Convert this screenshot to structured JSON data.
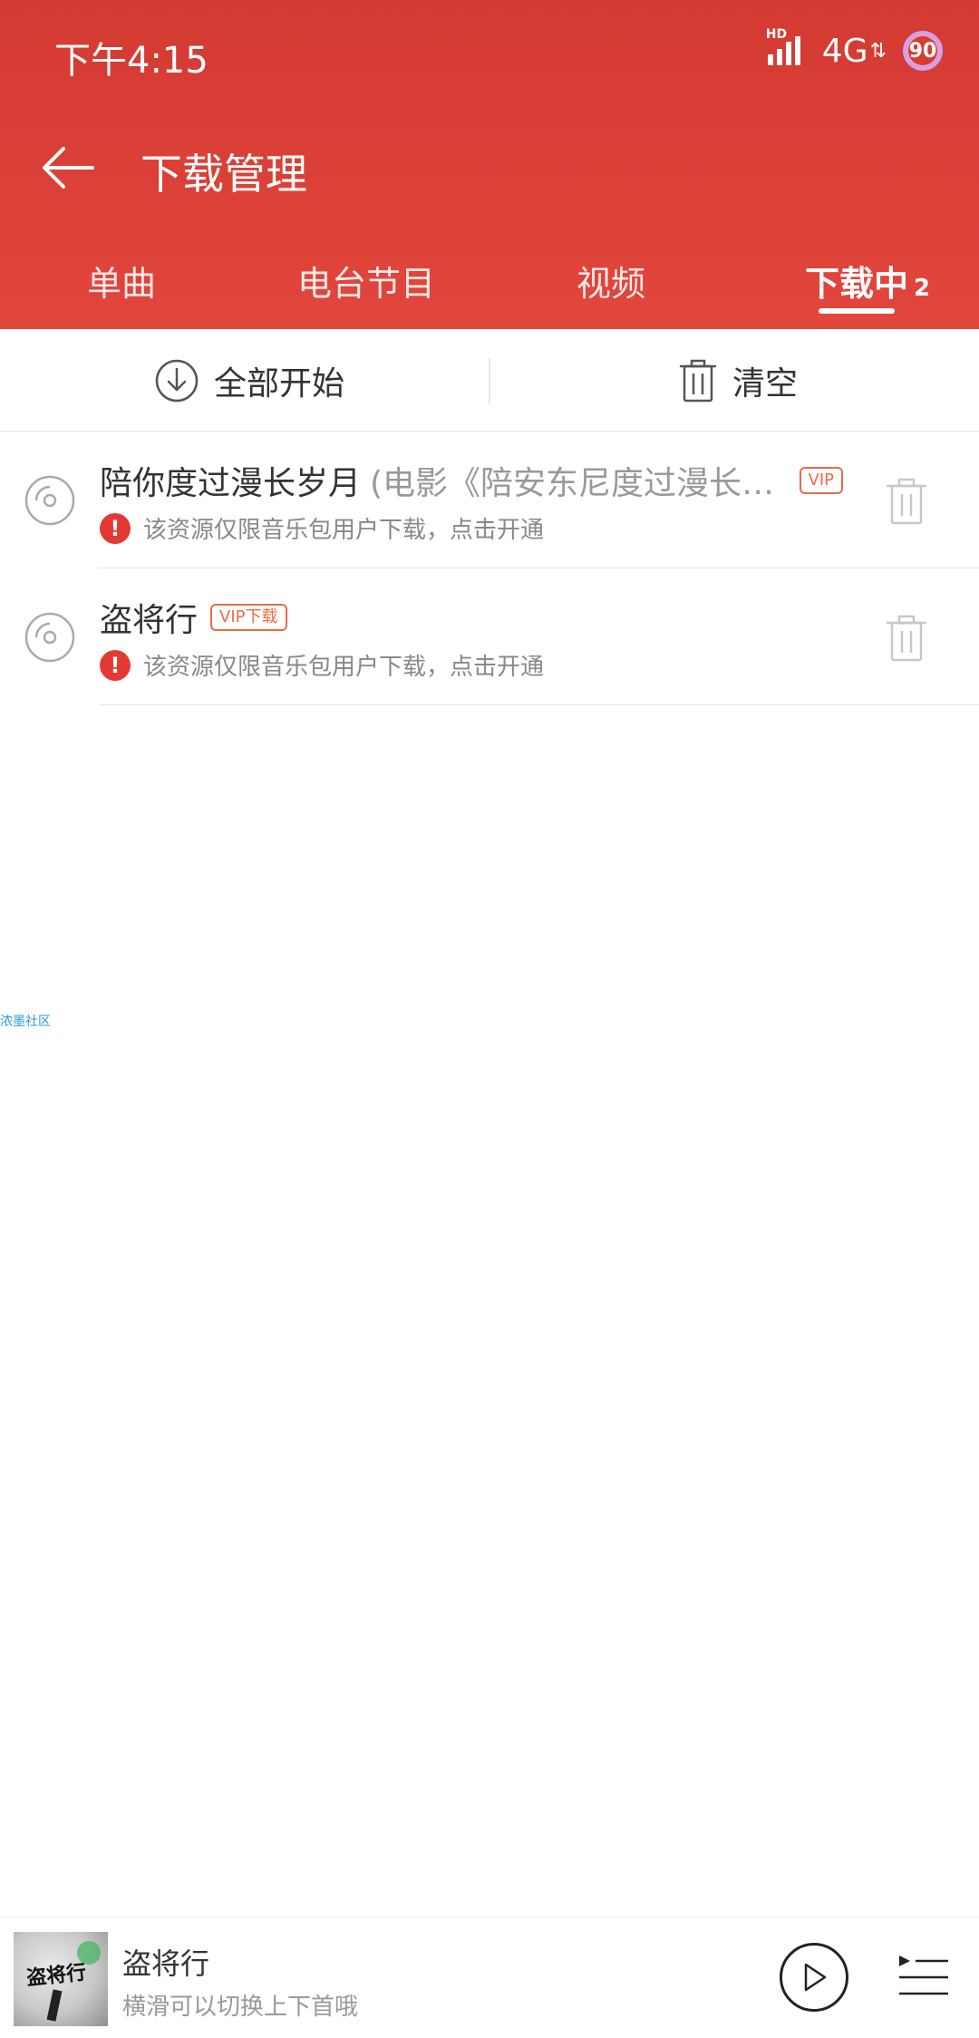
{
  "status_bar": {
    "time": "下午4:15",
    "network": "4G",
    "signal_badge": "HD",
    "battery": "90"
  },
  "titlebar": {
    "title": "下载管理"
  },
  "tabs": [
    {
      "label": "单曲",
      "active": false
    },
    {
      "label": "电台节目",
      "active": false
    },
    {
      "label": "视频",
      "active": false
    },
    {
      "label": "下载中",
      "badge": "2",
      "active": true
    }
  ],
  "actions": {
    "start_all": "全部开始",
    "clear": "清空"
  },
  "downloads": [
    {
      "title": "陪你度过漫长岁月",
      "subtitle": "(电影《陪安东尼度过漫长岁...",
      "tag": "VIP",
      "warning": "该资源仅限音乐包用户下载，点击开通"
    },
    {
      "title": "盗将行",
      "subtitle": "",
      "tag": "VIP下载",
      "warning": "该资源仅限音乐包用户下载，点击开通"
    }
  ],
  "watermark": "浓墨社区",
  "player": {
    "title": "盗将行",
    "hint": "横滑可以切换上下首哦",
    "album_art_text": "盗将行"
  },
  "colors": {
    "header_top": "#d33a31",
    "header_bottom": "#e2463d",
    "vip_tag": "#e96c46",
    "warning": "#e23a33"
  }
}
